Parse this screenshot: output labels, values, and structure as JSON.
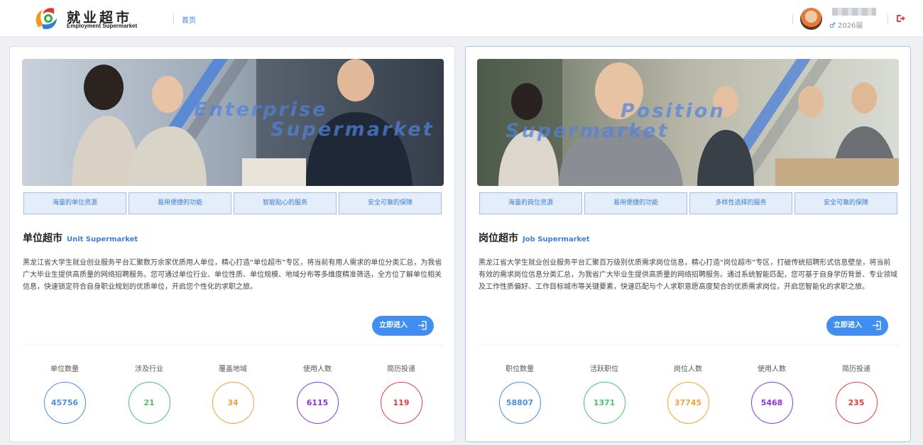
{
  "header": {
    "logo_title": "就业超市",
    "logo_subtitle": "Employment Supermarket",
    "nav_home": "首页",
    "user_year": "2026届"
  },
  "colors": {
    "accent": "#3c7fd8",
    "blue": "#4a8fe0",
    "green": "#49c46f",
    "orange": "#f2a13b",
    "purple": "#8a36e0",
    "red": "#e53f3a"
  },
  "unit": {
    "banner_text_1": "Enterprise",
    "banner_text_2": "Supermarket",
    "features": [
      "海量的单位资源",
      "易用便捷的功能",
      "智能贴心的服务",
      "安全可靠的保障"
    ],
    "title": "单位超市",
    "subtitle": "Unit Supermarket",
    "description": "黑龙江省大学生就业创业服务平台汇聚数万余家优质用人单位，精心打造“单位超市”专区，将当前有用人需求的单位分类汇总，为我省广大毕业生提供高质量的网络招聘服务。您可通过单位行业、单位性质、单位规模、地域分布等多维度精准筛选，全方位了解单位相关信息，快速锁定符合自身职业规划的优质单位，开启您个性化的求职之旅。",
    "enter_label": "立即进入",
    "stats": [
      {
        "label": "单位数量",
        "value": "45756",
        "color": "#4a8fe0"
      },
      {
        "label": "涉及行业",
        "value": "21",
        "color": "#49c46f"
      },
      {
        "label": "覆盖地域",
        "value": "34",
        "color": "#f2a13b"
      },
      {
        "label": "使用人数",
        "value": "6115",
        "color": "#8a36e0"
      },
      {
        "label": "简历投递",
        "value": "119",
        "color": "#e53f3a"
      }
    ]
  },
  "job": {
    "banner_text_1": "Position",
    "banner_text_2": "Supermarket",
    "features": [
      "海量的岗位资源",
      "易用便捷的功能",
      "多样性选择的服务",
      "安全可靠的保障"
    ],
    "title": "岗位超市",
    "subtitle": "Job Supermarket",
    "description": "黑龙江省大学生就业创业服务平台汇聚百万级别优质需求岗位信息，精心打造“岗位超市”专区，打破传统招聘形式信息壁垒，将当前有效的需求岗位信息分类汇总，为我省广大毕业生提供高质量的网络招聘服务。通过系统智能匹配，您可基于自身学历背景、专业领域及工作性质偏好、工作目标城市等关键要素，快速匹配与个人求职意愿高度契合的优质需求岗位，开启您智能化的求职之旅。",
    "enter_label": "立即进入",
    "stats": [
      {
        "label": "职位数量",
        "value": "58807",
        "color": "#4a8fe0"
      },
      {
        "label": "活跃职位",
        "value": "1371",
        "color": "#49c46f"
      },
      {
        "label": "岗位人数",
        "value": "37745",
        "color": "#f2a13b"
      },
      {
        "label": "使用人数",
        "value": "5468",
        "color": "#8a36e0"
      },
      {
        "label": "简历投递",
        "value": "235",
        "color": "#e53f3a"
      }
    ]
  }
}
